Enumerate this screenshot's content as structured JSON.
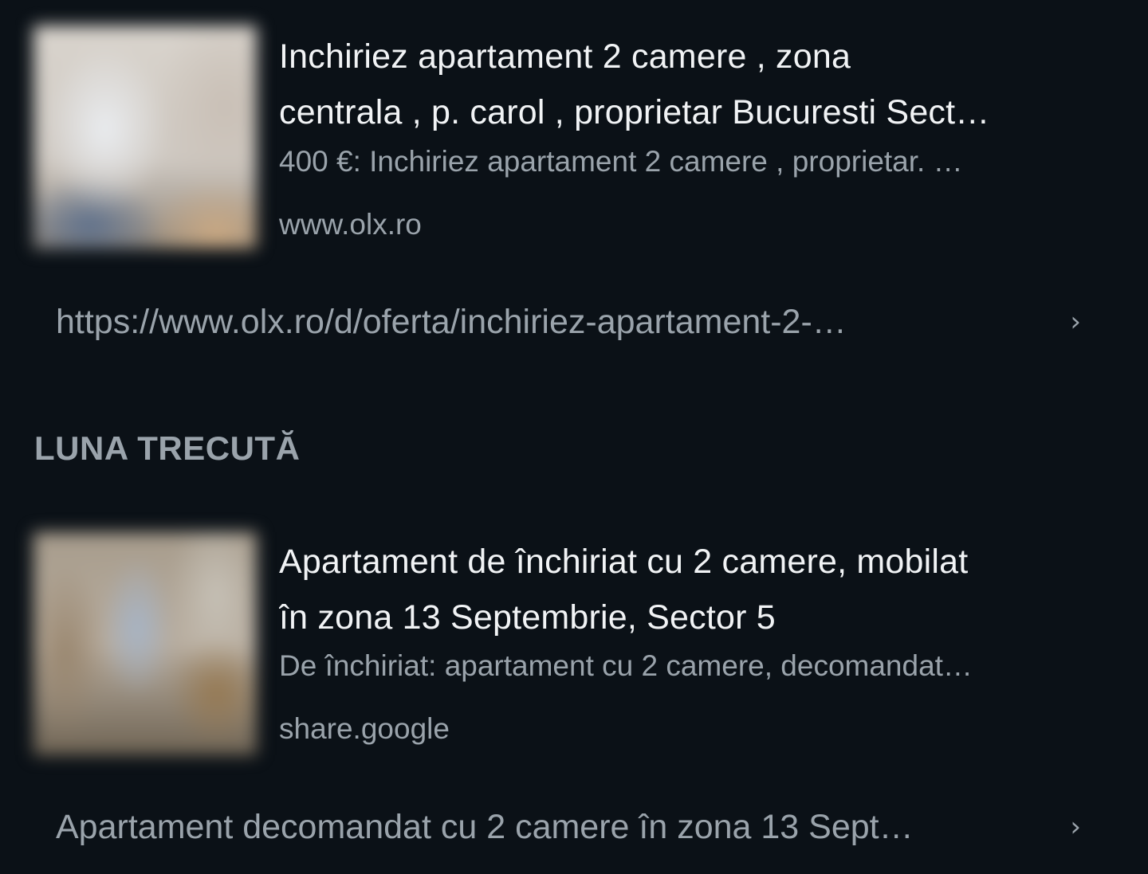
{
  "results": [
    {
      "thumbnail": "blurred-apartment-photo",
      "title_lines": [
        "Inchiriez apartament 2 camere , zona",
        "centrala , p. carol , proprietar Bucuresti Sect…"
      ],
      "snippet": "400 €: Inchiriez apartament 2 camere , proprietar. …",
      "domain": "www.olx.ro",
      "link": "https://www.olx.ro/d/oferta/inchiriez-apartament-2-…",
      "chevron": "›"
    },
    {
      "thumbnail": "blurred-apartment-photo",
      "title_lines": [
        "Apartament de închiriat cu 2 camere, mobilat",
        "în zona 13 Septembrie, Sector 5"
      ],
      "snippet": "De închiriat: apartament cu 2 camere, decomandat…",
      "domain": "share.google",
      "link": "Apartament decomandat cu 2 camere în zona 13 Sept…",
      "chevron": "›"
    }
  ],
  "section_header": "LUNA TRECUTĂ",
  "colors": {
    "background": "#0b1117",
    "title": "#f1f3f5",
    "secondary_text": "#9aa3ab"
  }
}
